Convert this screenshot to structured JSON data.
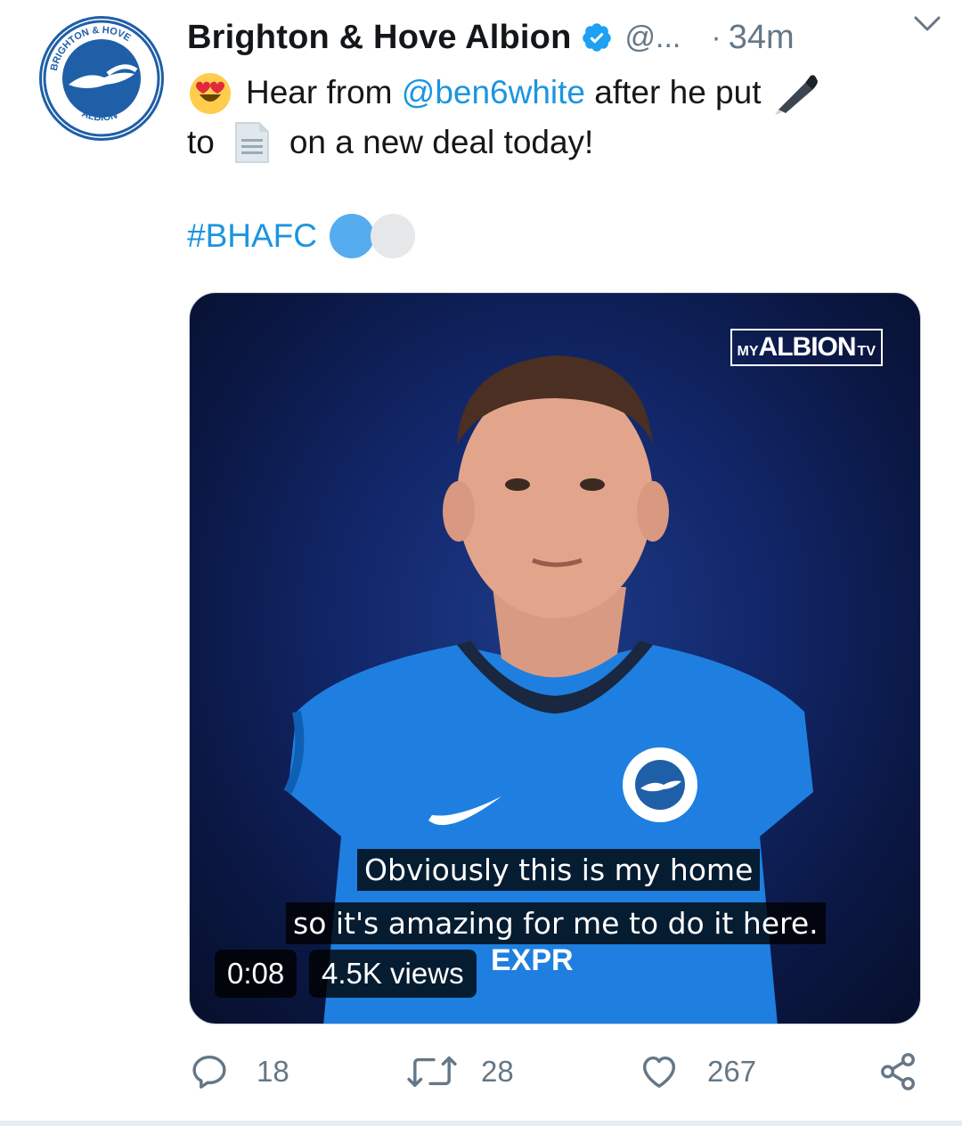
{
  "tweet": {
    "display_name": "Brighton & Hove Albion",
    "handle": "@...",
    "separator": "·",
    "time": "34m",
    "text_line1_pre": "Hear from ",
    "mention": "@ben6white",
    "text_line1_post": " after he put",
    "text_line2_pre": "to",
    "text_line2_post": "on a new deal today!",
    "hashtag": "#BHAFC"
  },
  "avatar": {
    "club_top": "BRIGHTON & HOVE",
    "club_bottom": "ALBION"
  },
  "media": {
    "channel_logo_my": "MY",
    "channel_logo_albion": "ALBION",
    "channel_logo_tv": "TV",
    "subtitle_line1": "Obviously this is my home",
    "subtitle_line2": "so it's amazing for me to do it here.",
    "duration": "0:08",
    "views": "4.5K views"
  },
  "actions": {
    "replies": "18",
    "retweets": "28",
    "likes": "267"
  },
  "colors": {
    "link": "#1b95e0",
    "secondary_text": "#657786",
    "verified": "#1da1f2",
    "kit_blue": "#1e7fe0"
  },
  "icons": [
    "verified-badge-icon",
    "chevron-down-icon",
    "heart-eyes-emoji",
    "pen-emoji",
    "document-emoji",
    "blue-circle-emoji",
    "white-circle-emoji",
    "reply-icon",
    "retweet-icon",
    "like-icon",
    "share-icon"
  ]
}
